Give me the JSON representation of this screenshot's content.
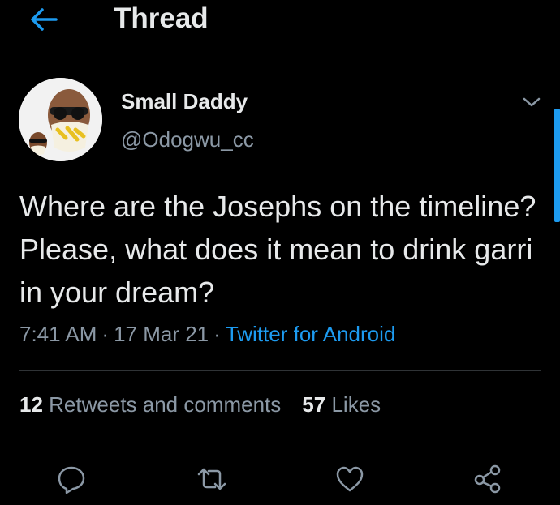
{
  "header": {
    "title": "Thread",
    "back_icon": "arrow-left-icon"
  },
  "colors": {
    "accent": "#1d9bf0",
    "background": "#000000",
    "text": "#e7e9ea",
    "muted": "#8b98a5"
  },
  "tweet": {
    "author_name": "Small Daddy",
    "author_handle": "@Odogwu_cc",
    "text": "Where are the Josephs on the timeline? Please, what does it mean to drink garri in your dream?",
    "time": "7:41 AM",
    "date": "17 Mar 21",
    "separator": "·",
    "source": "Twitter for Android"
  },
  "stats": {
    "retweets_count": "12",
    "retweets_label": "Retweets and comments",
    "likes_count": "57",
    "likes_label": "Likes"
  },
  "actions": [
    "reply-icon",
    "retweet-icon",
    "like-icon",
    "share-icon"
  ]
}
